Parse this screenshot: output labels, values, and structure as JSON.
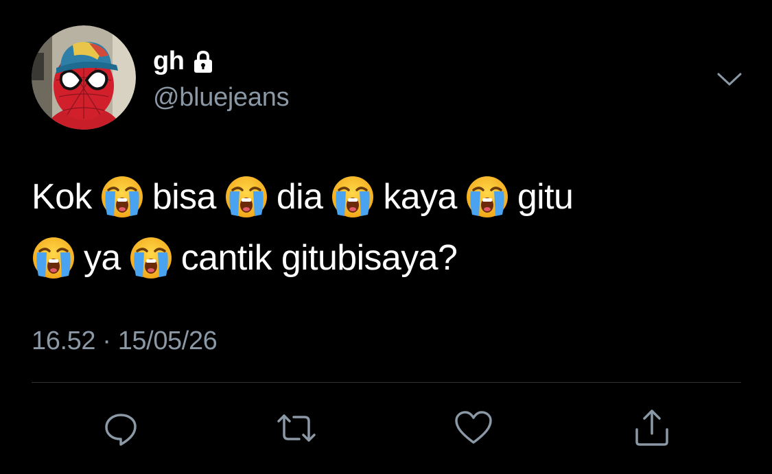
{
  "user": {
    "display_name": "gh",
    "handle": "@bluejeans",
    "protected_icon": "lock-icon",
    "avatar_description": "avatar-image"
  },
  "tweet": {
    "lines": [
      {
        "parts": [
          {
            "type": "text",
            "value": "Kok"
          },
          {
            "type": "emoji",
            "value": "😭"
          },
          {
            "type": "text",
            "value": "bisa"
          },
          {
            "type": "emoji",
            "value": "😭"
          },
          {
            "type": "text",
            "value": "dia"
          },
          {
            "type": "emoji",
            "value": "😭"
          },
          {
            "type": "text",
            "value": "kaya"
          },
          {
            "type": "emoji",
            "value": "😭"
          },
          {
            "type": "text",
            "value": "gitu"
          }
        ]
      },
      {
        "parts": [
          {
            "type": "emoji",
            "value": "😭"
          },
          {
            "type": "text",
            "value": "ya"
          },
          {
            "type": "emoji",
            "value": "😭"
          },
          {
            "type": "text",
            "value": "cantik gitubisaya?"
          }
        ]
      }
    ],
    "time": "16.52",
    "separator": "·",
    "date": "15/05/26"
  },
  "actions": {
    "reply_icon": "reply-icon",
    "retweet_icon": "retweet-icon",
    "like_icon": "heart-icon",
    "share_icon": "share-icon",
    "menu_icon": "chevron-down-icon"
  },
  "colors": {
    "background": "#000000",
    "primary_text": "#ffffff",
    "secondary_text": "#8b98a5",
    "divider": "#2f3336"
  }
}
